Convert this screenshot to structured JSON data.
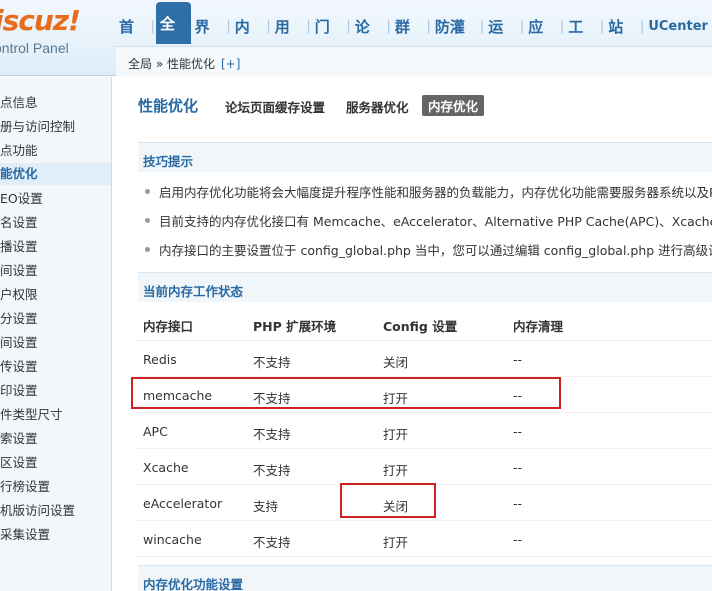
{
  "logo": {
    "text": "iscuz!",
    "subtitle": "ontrol Panel"
  },
  "nav": [
    "首页",
    "全局",
    "界面",
    "内容",
    "用户",
    "门户",
    "论坛",
    "群组",
    "防灌水",
    "运营",
    "应用",
    "工具",
    "站长",
    "UCenter"
  ],
  "breadcrumb": {
    "text": "全局 » 性能优化",
    "plus": "[+]"
  },
  "sidebar": [
    "点信息",
    "册与访问控制",
    "点功能",
    "能优化",
    "EO设置",
    "名设置",
    "播设置",
    "间设置",
    "户权限",
    "分设置",
    "间设置",
    "传设置",
    "印设置",
    "件类型尺寸",
    "索设置",
    "区设置",
    "行榜设置",
    "机版访问设置",
    "采集设置"
  ],
  "page": {
    "title": "性能优化",
    "tabs": [
      "论坛页面缓存设置",
      "服务器优化",
      "内存优化"
    ]
  },
  "tips": {
    "header": "技巧提示",
    "items": [
      "启用内存优化功能将会大幅度提升程序性能和服务器的负载能力，内存优化功能需要服务器系统以及PHP",
      "目前支持的内存优化接口有 Memcache、eAccelerator、Alternative PHP Cache(APC)、Xcache",
      "内存接口的主要设置位于 config_global.php 当中，您可以通过编辑 config_global.php 进行高级设"
    ]
  },
  "status": {
    "header": "当前内存工作状态",
    "columns": [
      "内存接口",
      "PHP 扩展环境",
      "Config 设置",
      "内存清理"
    ],
    "rows": [
      [
        "Redis",
        "不支持",
        "关闭",
        "--"
      ],
      [
        "memcache",
        "不支持",
        "打开",
        "--"
      ],
      [
        "APC",
        "不支持",
        "打开",
        "--"
      ],
      [
        "Xcache",
        "不支持",
        "打开",
        "--"
      ],
      [
        "eAccelerator",
        "支持",
        "关闭",
        "--"
      ],
      [
        "wincache",
        "不支持",
        "打开",
        "--"
      ]
    ]
  },
  "settings": {
    "header": "内存优化功能设置"
  },
  "colors": {
    "accent": "#2a6aa3",
    "logo": "#e96b1c",
    "highlight": "#cc2222"
  }
}
